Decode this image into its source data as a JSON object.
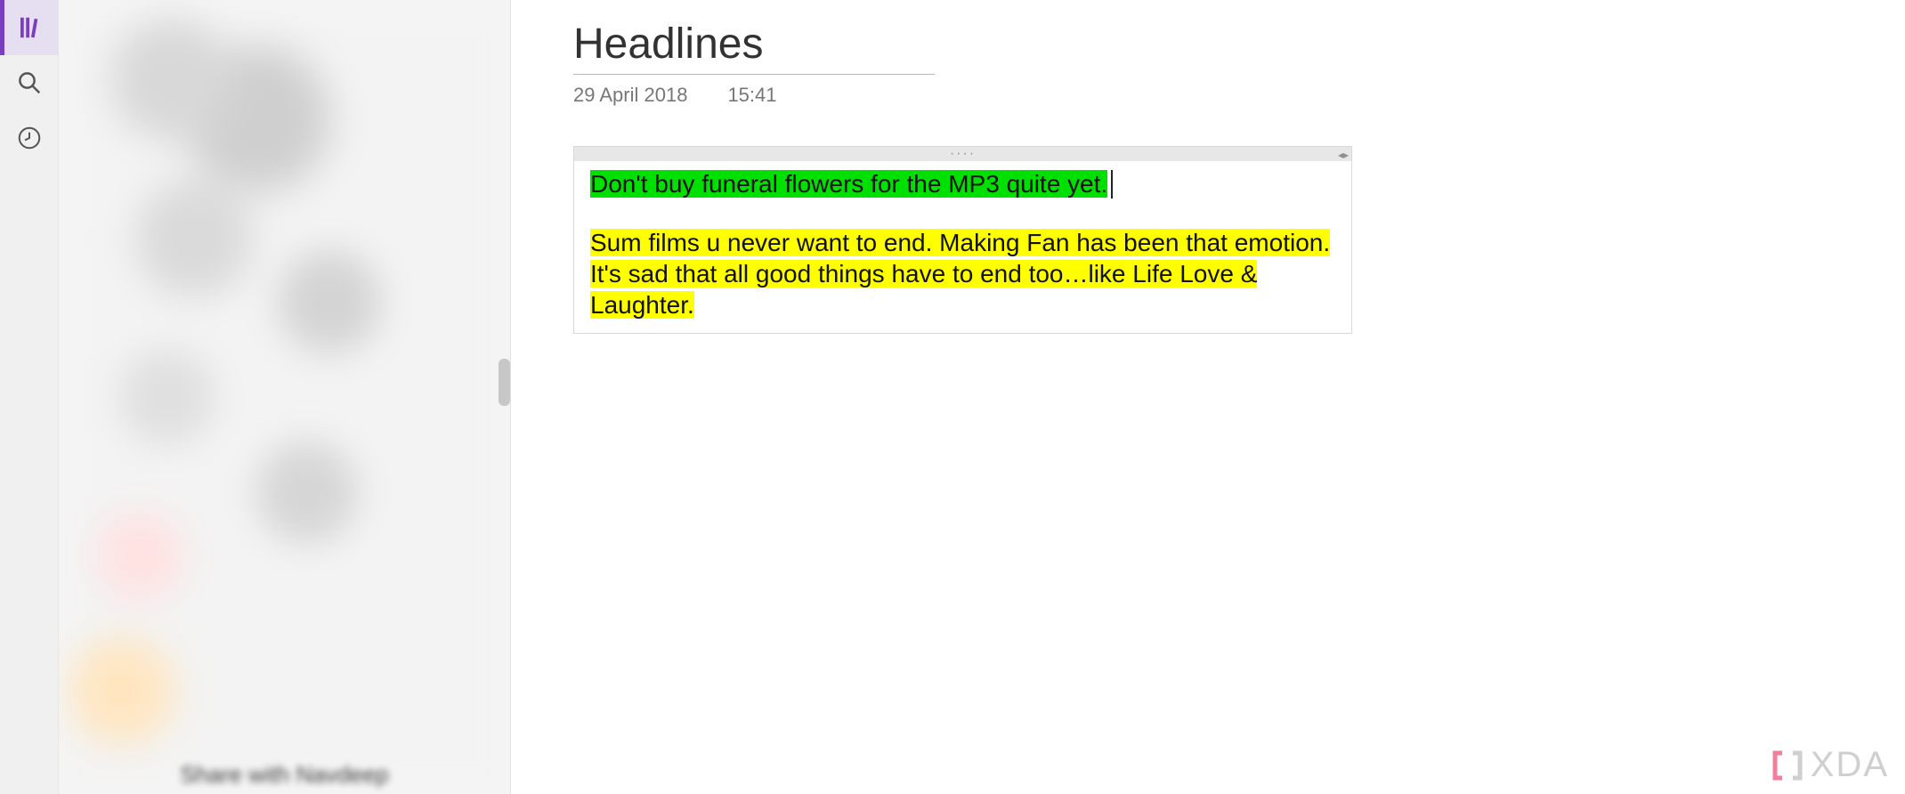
{
  "sidebar": {
    "items": [
      {
        "name": "notebooks",
        "icon": "books-icon",
        "active": true
      },
      {
        "name": "search",
        "icon": "search-icon",
        "active": false
      },
      {
        "name": "recent",
        "icon": "clock-icon",
        "active": false
      }
    ]
  },
  "notesList": {
    "blurredFooterText": "Share with Navdeep"
  },
  "editor": {
    "title": "Headlines",
    "date": "29 April 2018",
    "time": "15:41",
    "note": {
      "line1": "Don't buy funeral flowers for the MP3 quite yet.",
      "line2": "Sum films u never want to end. Making Fan has been that emotion. It's sad that all good things have to end too…like Life Love & Laughter."
    }
  },
  "watermark": {
    "text": "XDA"
  }
}
